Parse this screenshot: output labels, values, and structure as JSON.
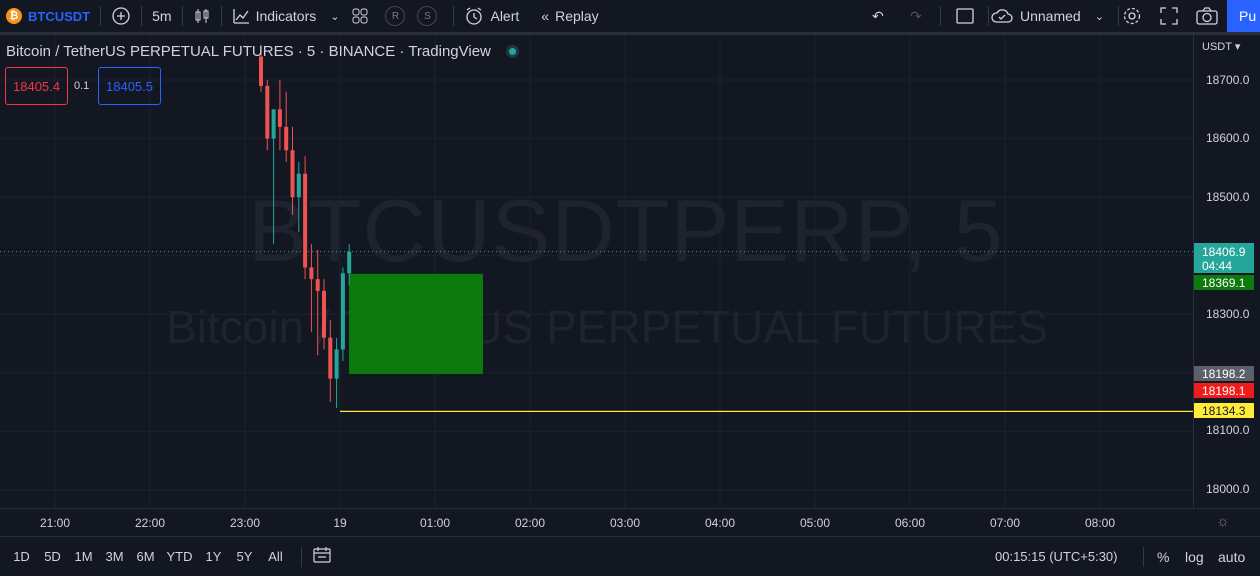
{
  "toolbar": {
    "symbol": "BTCUSDT",
    "interval": "5m",
    "indicators": "Indicators",
    "r_label": "R",
    "s_label": "S",
    "alert": "Alert",
    "replay": "Replay",
    "layout_name": "Unnamed",
    "publish": "Pu"
  },
  "legend": {
    "title": "Bitcoin / TetherUS PERPETUAL FUTURES · 5 · BINANCE · TradingView",
    "sell_price": "18405.4",
    "spread": "0.1",
    "buy_price": "18405.5"
  },
  "watermark": {
    "symbol": "BTCUSDTPERP, 5",
    "name": "Bitcoin / TetherUS PERPETUAL FUTURES"
  },
  "price_axis": {
    "currency": "USDT",
    "ticks": [
      "18700.0",
      "18600.0",
      "18500.0",
      "18300.0",
      "18100.0",
      "18000.0"
    ],
    "last_price": "18406.9",
    "countdown": "04:44",
    "box_top_price": "18369.1",
    "box_bottom_grey": "18198.2",
    "box_bottom_red": "18198.1",
    "line_price": "18134.3"
  },
  "time_axis": {
    "ticks": [
      "21:00",
      "22:00",
      "23:00",
      "19",
      "01:00",
      "02:00",
      "03:00",
      "04:00",
      "05:00",
      "06:00",
      "07:00",
      "08:00"
    ]
  },
  "bottom": {
    "ranges": [
      "1D",
      "5D",
      "1M",
      "3M",
      "6M",
      "YTD",
      "1Y",
      "5Y",
      "All"
    ],
    "clock": "00:15:15 (UTC+5:30)",
    "percent": "%",
    "log": "log",
    "auto": "auto"
  },
  "colors": {
    "up": "#26a69a",
    "down": "#ef5350",
    "box_fill": "#0d7a0d",
    "line": "#ffeb3b",
    "accent": "#2962ff"
  },
  "chart_data": {
    "type": "candlestick",
    "timeframe": "5",
    "candles_ohlc": [
      [
        18740,
        18760,
        18680,
        18690
      ],
      [
        18690,
        18700,
        18580,
        18600
      ],
      [
        18600,
        18640,
        18420,
        18650
      ],
      [
        18650,
        18700,
        18580,
        18620
      ],
      [
        18620,
        18680,
        18560,
        18580
      ],
      [
        18580,
        18620,
        18470,
        18500
      ],
      [
        18500,
        18560,
        18440,
        18540
      ],
      [
        18540,
        18570,
        18360,
        18380
      ],
      [
        18380,
        18420,
        18270,
        18360
      ],
      [
        18360,
        18410,
        18230,
        18340
      ],
      [
        18340,
        18360,
        18240,
        18260
      ],
      [
        18260,
        18290,
        18150,
        18190
      ],
      [
        18190,
        18260,
        18140,
        18240
      ],
      [
        18240,
        18380,
        18220,
        18370
      ],
      [
        18370,
        18420,
        18350,
        18407
      ]
    ],
    "box": {
      "top": 18369.1,
      "bottom": 18198.1
    },
    "horizontal_line": 18134.3,
    "last_price": 18406.9
  }
}
